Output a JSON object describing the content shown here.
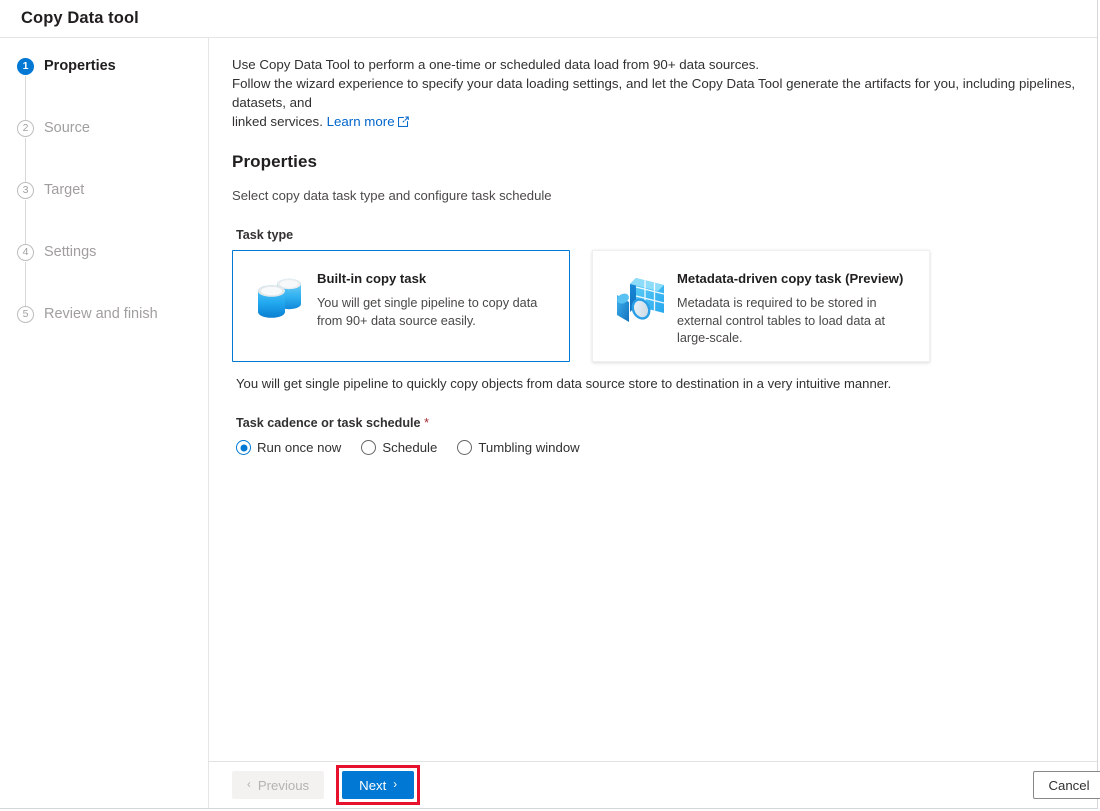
{
  "window": {
    "title": "Copy Data tool"
  },
  "sidebar": {
    "steps": [
      {
        "number": "1",
        "label": "Properties",
        "state": "active"
      },
      {
        "number": "2",
        "label": "Source",
        "state": "inactive"
      },
      {
        "number": "3",
        "label": "Target",
        "state": "inactive"
      },
      {
        "number": "4",
        "label": "Settings",
        "state": "inactive"
      },
      {
        "number": "5",
        "label": "Review and finish",
        "state": "inactive"
      }
    ]
  },
  "intro": {
    "line1": "Use Copy Data Tool to perform a one-time or scheduled data load from 90+ data sources.",
    "line2": "Follow the wizard experience to specify your data loading settings, and let the Copy Data Tool generate the artifacts for you, including pipelines, datasets, and",
    "line3_prefix": "linked services.",
    "link_text": "Learn more"
  },
  "section": {
    "title": "Properties",
    "subtitle": "Select copy data task type and configure task schedule"
  },
  "task_type": {
    "label": "Task type",
    "cards": [
      {
        "title": "Built-in copy task",
        "description": "You will get single pipeline to copy data from 90+ data source easily.",
        "icon": "database-cylinders-icon",
        "selected": true
      },
      {
        "title": "Metadata-driven copy task (Preview)",
        "description": "Metadata is required to be stored in external control tables to load data at large-scale.",
        "icon": "metadata-table-magnifier-icon",
        "selected": false
      }
    ],
    "note": "You will get single pipeline to quickly copy objects from data source store to destination in a very intuitive manner."
  },
  "cadence": {
    "label": "Task cadence or task schedule",
    "required_marker": "*",
    "options": [
      {
        "label": "Run once now",
        "checked": true
      },
      {
        "label": "Schedule",
        "checked": false
      },
      {
        "label": "Tumbling window",
        "checked": false
      }
    ]
  },
  "footer": {
    "previous_label": "Previous",
    "next_label": "Next",
    "cancel_label": "Cancel",
    "previous_chevron": "‹",
    "next_chevron": "›"
  },
  "colors": {
    "accent": "#0078d4",
    "highlight": "#e8112d",
    "link": "#0066cc",
    "required": "#a4262c"
  }
}
